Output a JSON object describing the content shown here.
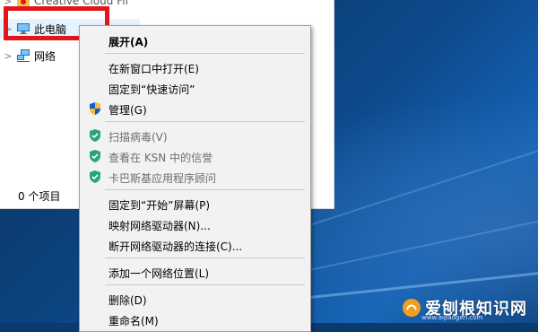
{
  "nav": {
    "items": [
      {
        "label": "Creative Cloud Fil",
        "chevron": ">"
      },
      {
        "label": "此电脑",
        "chevron": ">"
      },
      {
        "label": "网络",
        "chevron": ">"
      }
    ]
  },
  "status": {
    "items_count": "0 个项目"
  },
  "menu": {
    "items": [
      {
        "label": "展开(A)",
        "icon": null
      },
      {
        "label": "在新窗口中打开(E)",
        "icon": null
      },
      {
        "label": "固定到“快速访问”",
        "icon": null
      },
      {
        "label": "管理(G)",
        "icon": "uac-shield-icon"
      },
      {
        "label": "扫描病毒(V)",
        "icon": "kaspersky-shield-icon"
      },
      {
        "label": "查看在 KSN 中的信誉",
        "icon": "kaspersky-shield-icon"
      },
      {
        "label": "卡巴斯基应用程序顾问",
        "icon": "kaspersky-shield-icon"
      },
      {
        "label": "固定到“开始”屏幕(P)",
        "icon": null
      },
      {
        "label": "映射网络驱动器(N)...",
        "icon": null
      },
      {
        "label": "断开网络驱动器的连接(C)...",
        "icon": null
      },
      {
        "label": "添加一个网络位置(L)",
        "icon": null
      },
      {
        "label": "删除(D)",
        "icon": null
      },
      {
        "label": "重命名(M)",
        "icon": null
      }
    ]
  },
  "watermark": {
    "text": "爱刨根知识网",
    "domain": "www.aipaogen.com"
  },
  "colors": {
    "highlight": "#e2151b",
    "accent": "#0078d7",
    "kaspersky": "#2aa57a"
  }
}
